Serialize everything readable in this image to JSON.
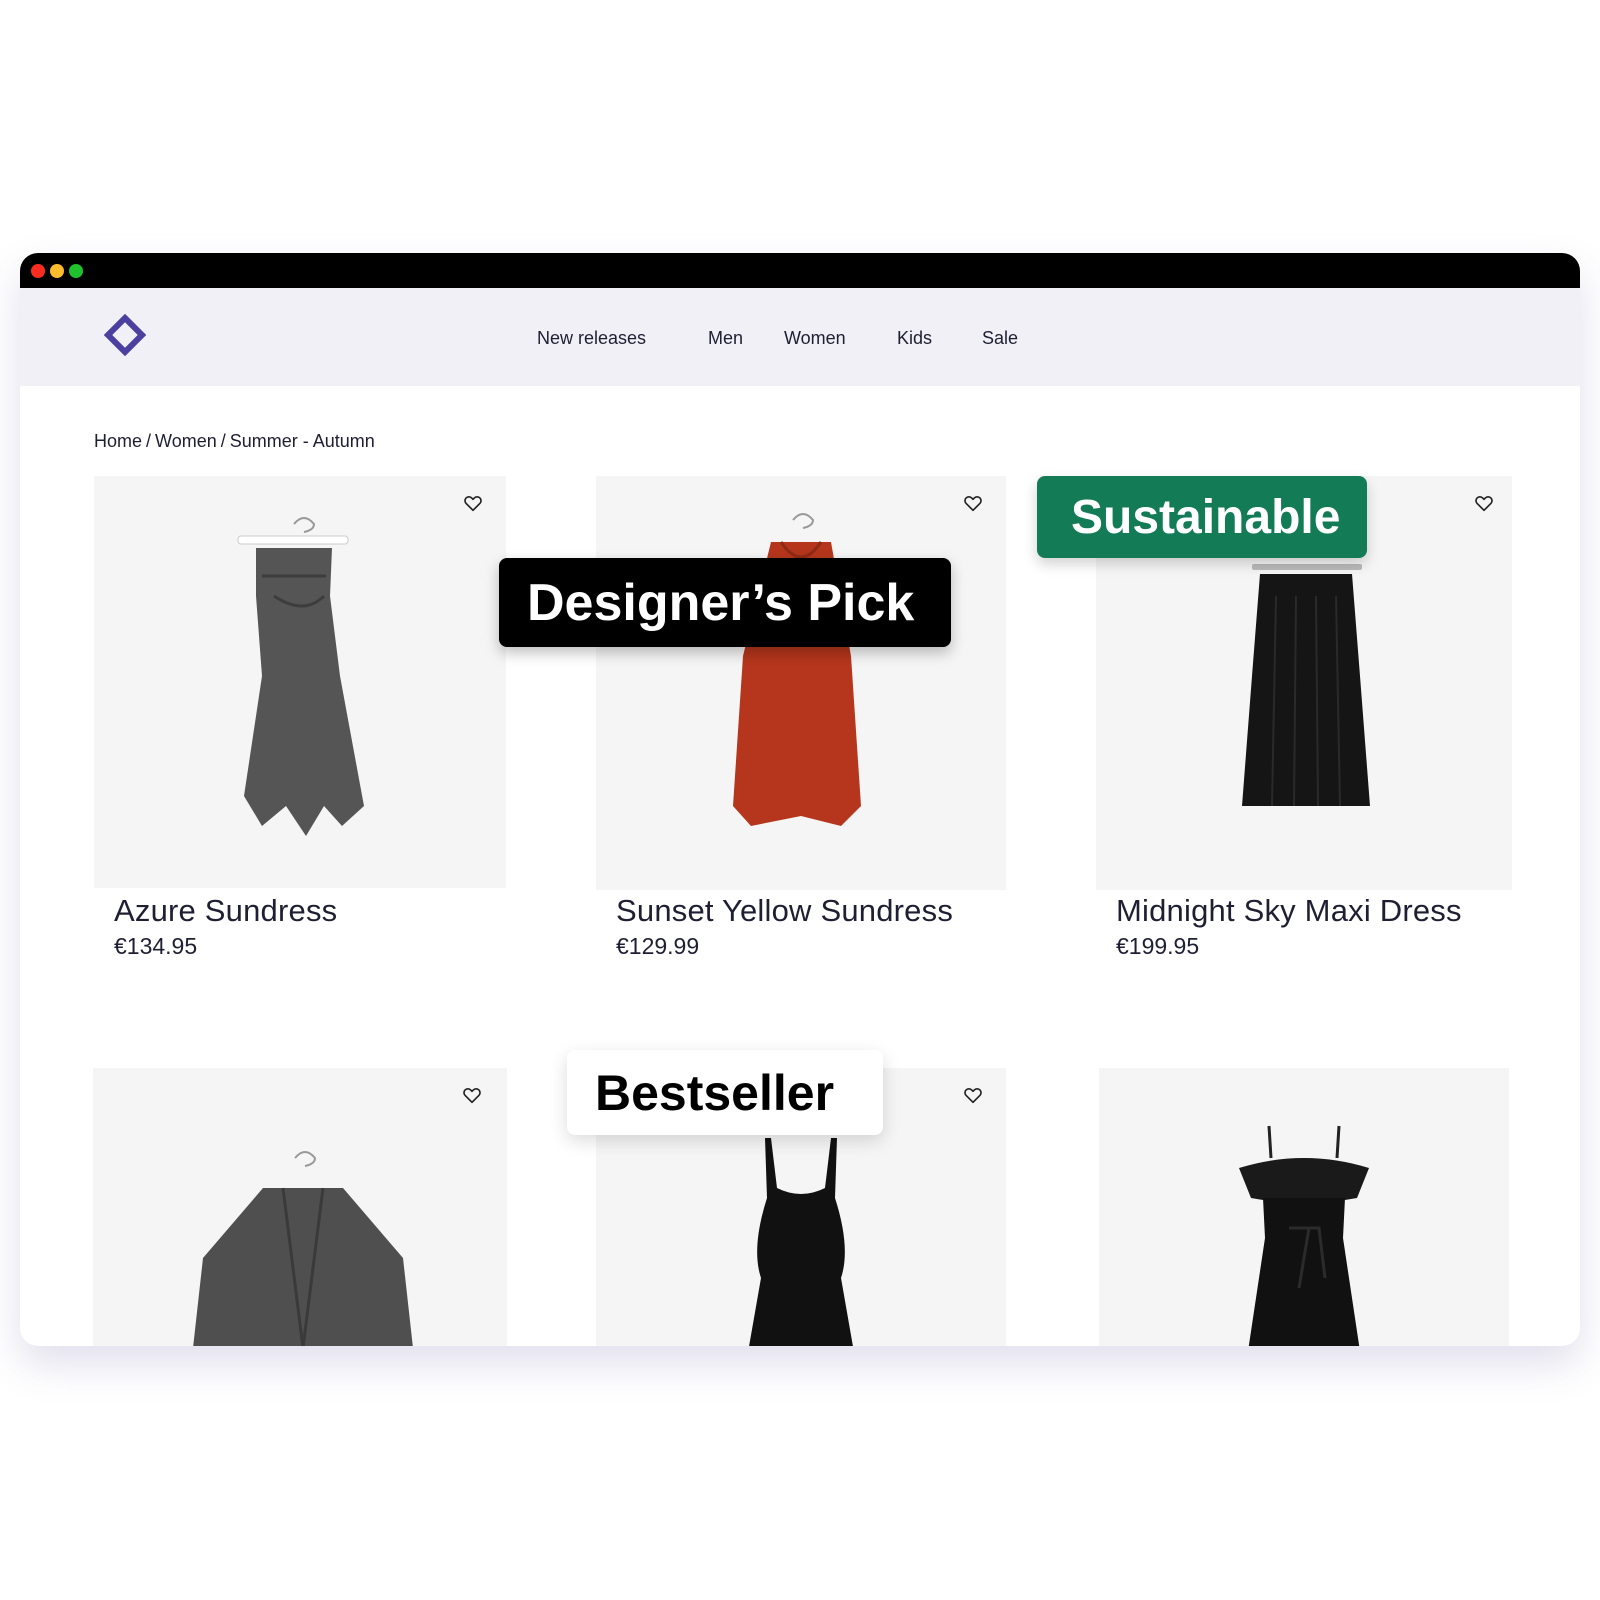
{
  "nav": {
    "links": [
      "New releases",
      "Men",
      "Women",
      "Kids",
      "Sale"
    ]
  },
  "breadcrumb": [
    "Home",
    "Women",
    "Summer - Autumn"
  ],
  "breadcrumb_separator": "/",
  "products": [
    {
      "name": "Azure Sundress",
      "price": "€134.95"
    },
    {
      "name": "Sunset Yellow Sundress",
      "price": "€129.99"
    },
    {
      "name": "Midnight Sky Maxi Dress",
      "price": "€199.95"
    }
  ],
  "badges": {
    "designer": "Designer’s Pick",
    "sustainable": "Sustainable",
    "bestseller": "Bestseller"
  },
  "colors": {
    "brand": "#4b3fa0",
    "nav_bg": "#f0f0f6",
    "sustainable_badge": "#137c56",
    "text": "#1f1f33",
    "image_bg": "#f5f5f5"
  },
  "icons": {
    "logo": "diamond-outline-icon",
    "favorite": "heart-outline-icon"
  }
}
